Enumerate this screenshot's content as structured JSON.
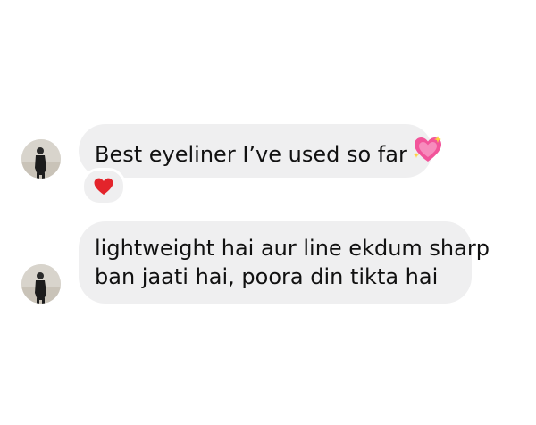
{
  "messages": [
    {
      "text": "Best eyeliner I’ve used so far",
      "trailing_emoji": "sparkling-heart",
      "reaction": "red-heart"
    },
    {
      "line1": "lightweight hai aur line ekdum sharp",
      "line2": "ban jaati hai, poora din tikta hai"
    }
  ],
  "colors": {
    "bubble_bg": "#efeff0",
    "text": "#111111",
    "heart_red": "#e3242b",
    "sparkle_pink": "#f2549a"
  }
}
